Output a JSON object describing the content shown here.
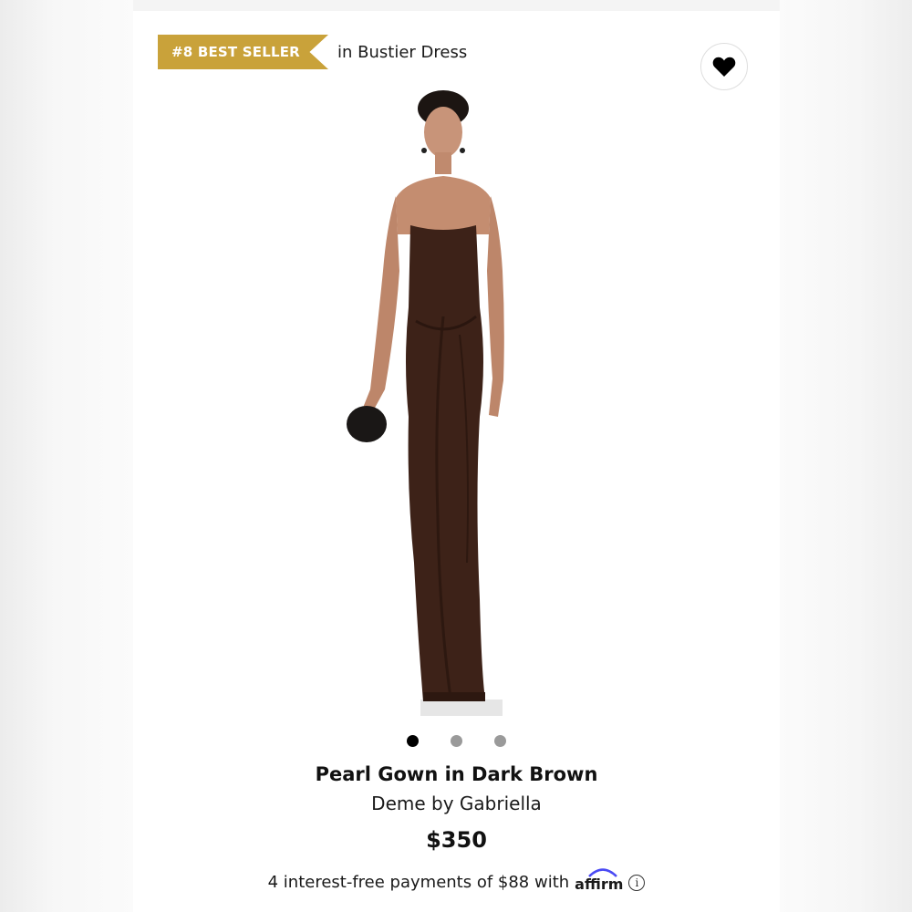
{
  "badge": {
    "rank_text": "#8 BEST SELLER",
    "context": "in Bustier Dress"
  },
  "wishlist": {
    "icon": "heart-icon"
  },
  "gallery": {
    "slide_count": 3,
    "active_index": 0
  },
  "product": {
    "title": "Pearl Gown in Dark Brown",
    "brand": "Deme by Gabriella",
    "price": "$350"
  },
  "payments": {
    "text": "4 interest-free payments of $88 with",
    "provider": "affirm",
    "info_icon": "info-icon"
  },
  "colors": {
    "badge": "#c9a23a",
    "dress": "#3d2218"
  }
}
